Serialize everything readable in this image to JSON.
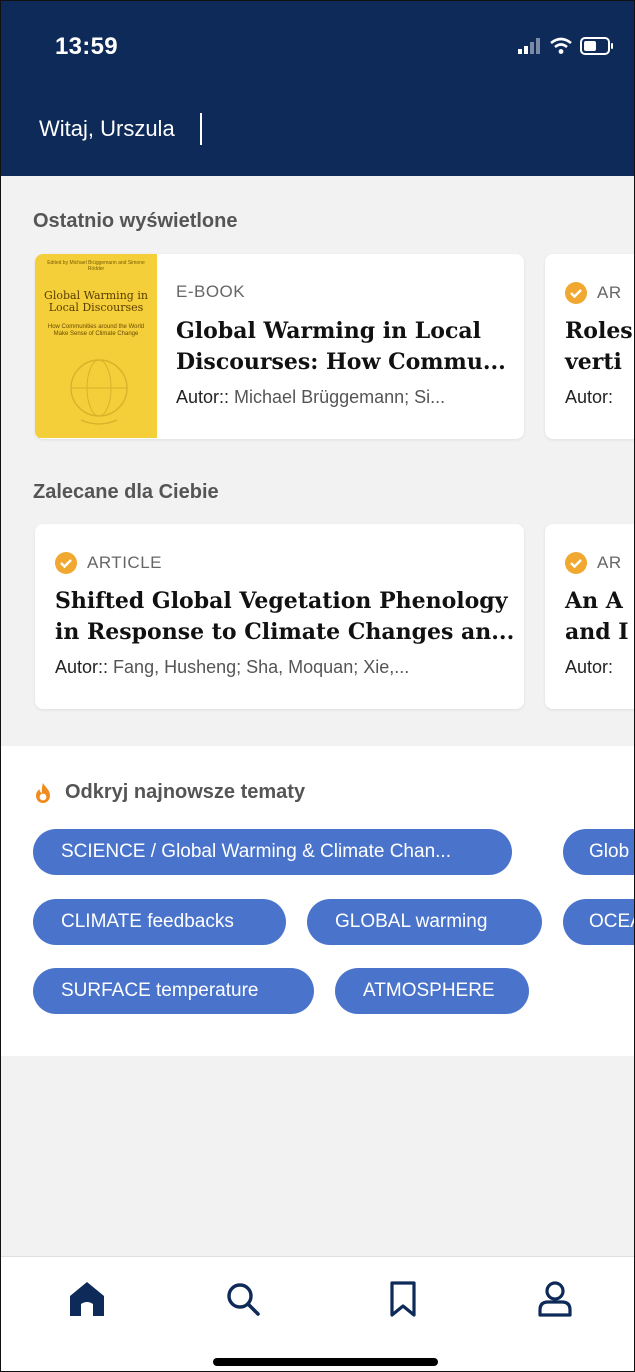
{
  "status_bar": {
    "time": "13:59"
  },
  "header": {
    "greeting": "Witaj, Urszula"
  },
  "recent": {
    "title": "Ostatnio wyświetlone",
    "items": [
      {
        "type": "E-BOOK",
        "title_line1": "Global Warming in Local",
        "title_line2": "Discourses: How Commu...",
        "author_label": "Autor::",
        "authors": "Michael Brüggemann; Si...",
        "cover": {
          "editors": "Edited by Michael Brüggemann and Simone Rödder",
          "title": "Global Warming in Local Discourses",
          "subtitle": "How Communities around the World Make Sense of Climate Change"
        }
      },
      {
        "type": "AR",
        "title_line1": "Roles",
        "title_line2": "verti",
        "author_label": "Autor:"
      }
    ]
  },
  "recommended": {
    "title": "Zalecane dla Ciebie",
    "items": [
      {
        "type": "ARTICLE",
        "title_line1": "Shifted Global Vegetation Phenology",
        "title_line2": "in Response to Climate Changes an...",
        "author_label": "Autor::",
        "authors": "Fang, Husheng; Sha, Moquan; Xie,..."
      },
      {
        "type": "AR",
        "title_line1": "An A",
        "title_line2": "and I",
        "author_label": "Autor:"
      }
    ]
  },
  "topics": {
    "title": "Odkryj najnowsze tematy",
    "chips": [
      "SCIENCE / Global Warming & Climate Chan...",
      "Glob",
      "CLIMATE feedbacks",
      "GLOBAL warming",
      "OCEA",
      "SURFACE temperature",
      "ATMOSPHERE"
    ]
  },
  "nav": {
    "items": [
      "home-icon",
      "search-icon",
      "bookmark-icon",
      "profile-icon"
    ]
  },
  "colors": {
    "header_bg": "#0e2a58",
    "chip_bg": "#4a74cc",
    "badge": "#f0a830",
    "flame": "#f08a1c"
  }
}
